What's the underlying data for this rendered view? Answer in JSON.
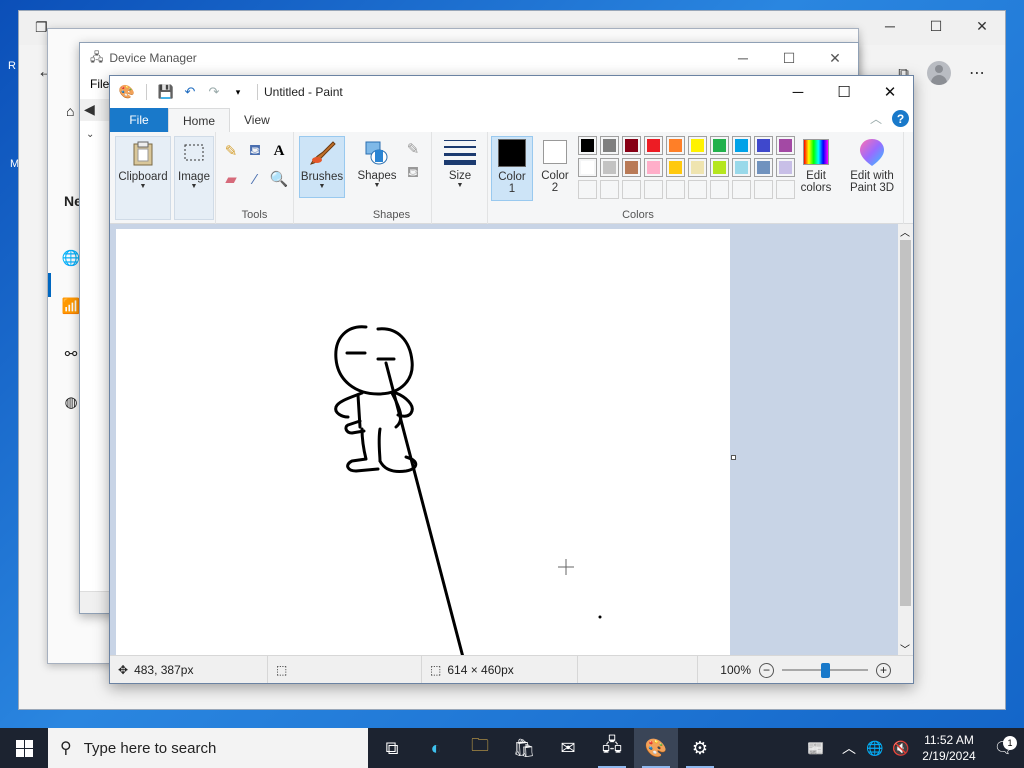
{
  "desktop": {
    "left_chars": [
      "R",
      "M"
    ]
  },
  "settings_window": {
    "controls": {
      "minimize": "─",
      "maximize": "☐",
      "close": "✕"
    },
    "left_nav_initial": "Ne"
  },
  "back_window": {
    "title_partial": ""
  },
  "device_manager": {
    "title": "Device Manager",
    "menu_file": "File",
    "controls": {
      "minimize": "─",
      "maximize": "☐",
      "close": "✕"
    }
  },
  "paint": {
    "title": "Untitled - Paint",
    "tabs": {
      "file": "File",
      "home": "Home",
      "view": "View"
    },
    "groups": {
      "clipboard": "Clipboard",
      "image": "Image",
      "tools": "Tools",
      "brushes": "Brushes",
      "shapes_btn": "Shapes",
      "shapes_group": "Shapes",
      "size": "Size",
      "color1": "Color\n1",
      "color1_line1": "Color",
      "color1_line2": "1",
      "color2_line1": "Color",
      "color2_line2": "2",
      "colors_group": "Colors",
      "edit_colors_line1": "Edit",
      "edit_colors_line2": "colors",
      "paint3d_line1": "Edit with",
      "paint3d_line2": "Paint 3D"
    },
    "palette_row1": [
      "#000000",
      "#7f7f7f",
      "#880015",
      "#ed1c24",
      "#ff7f27",
      "#fff200",
      "#22b14c",
      "#00a2e8",
      "#3f48cc",
      "#a349a4"
    ],
    "palette_row2": [
      "#ffffff",
      "#c3c3c3",
      "#b97a57",
      "#ffaec9",
      "#ffc90e",
      "#efe4b0",
      "#b5e61d",
      "#99d9ea",
      "#7092be",
      "#c8bfe7"
    ],
    "color1_value": "#000000",
    "color2_value": "#ffffff",
    "status": {
      "cursor_pos": "483, 387px",
      "canvas_size": "614 × 460px",
      "zoom": "100%",
      "zoom_level_fraction": 0.5
    }
  },
  "taskbar": {
    "search_placeholder": "Type here to search",
    "time": "11:52 AM",
    "date": "2/19/2024",
    "notification_count": "1"
  }
}
